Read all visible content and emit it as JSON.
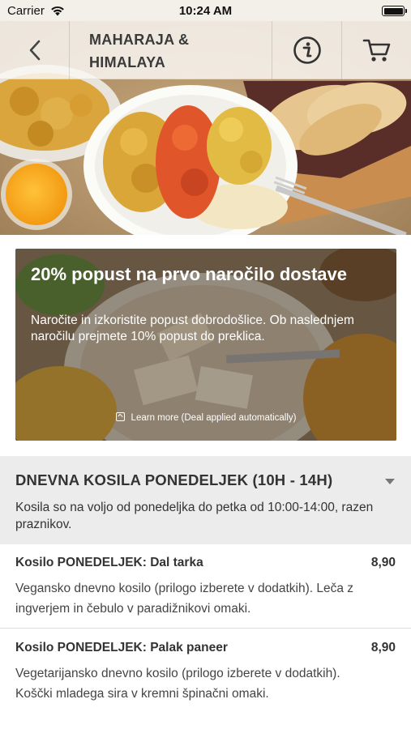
{
  "status_bar": {
    "carrier": "Carrier",
    "time": "10:24 AM"
  },
  "nav": {
    "title_line1": "MAHARAJA &",
    "title_line2": "HIMALAYA",
    "icons": [
      "back-chevron-icon",
      "info-icon",
      "cart-icon"
    ]
  },
  "promo": {
    "title": "20% popust na prvo naročilo dostave",
    "text": "Naročite in izkoristite popust dobrodošlice. Ob naslednjem naročilu prejmete 10% popust do preklica.",
    "learn_more": "Learn more (Deal applied automatically)"
  },
  "category": {
    "title": "DNEVNA KOSILA PONEDELJEK (10H - 14H)",
    "description": "Kosila so na voljo od ponedeljka do petka od 10:00-14:00, razen praznikov."
  },
  "items": [
    {
      "name": "Kosilo PONEDELJEK: Dal tarka",
      "price": "8,90",
      "description": "Vegansko dnevno kosilo (prilogo izberete v dodatkih). Leča z ingverjem in čebulo v paradižnikovi omaki."
    },
    {
      "name": "Kosilo PONEDELJEK: Palak paneer",
      "price": "8,90",
      "description": "Vegetarijansko dnevno kosilo (prilogo izberete v dodatkih). Koščki mladega sira v kremni špinačni omaki."
    }
  ],
  "colors": {
    "category_bg": "#ececec",
    "text_dark": "#333333"
  }
}
